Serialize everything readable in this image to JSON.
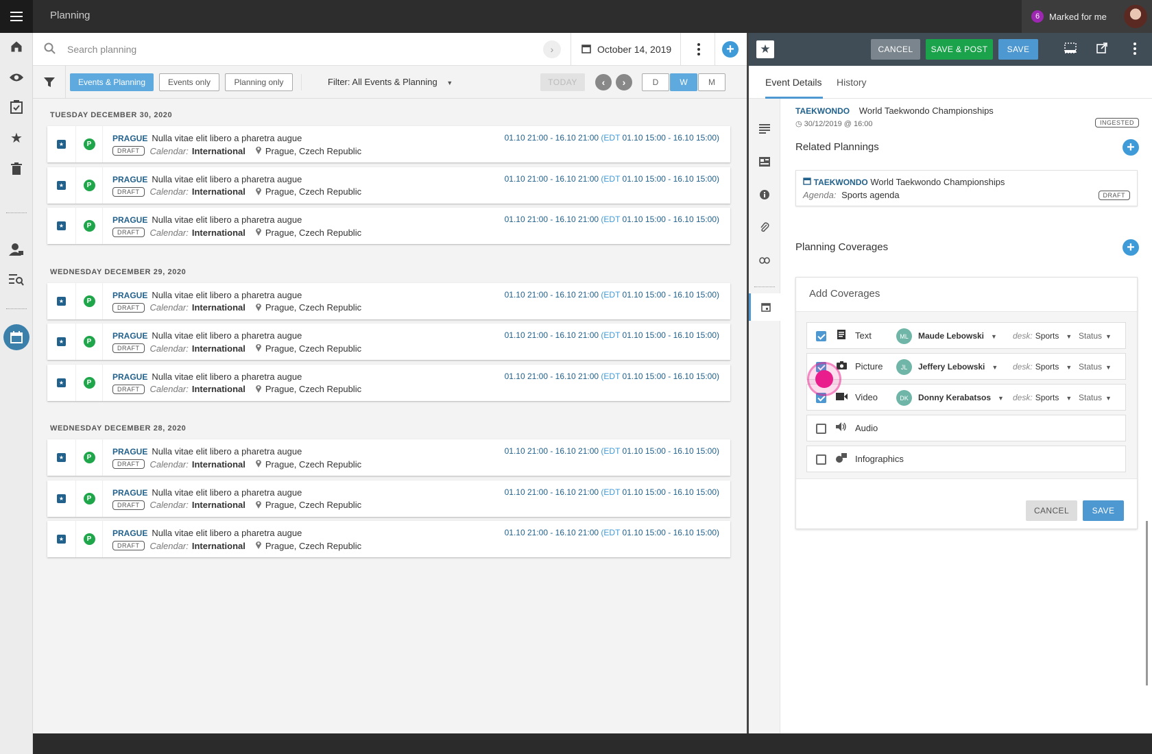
{
  "app": {
    "title": "Planning",
    "marked_count": "6",
    "marked_label": "Marked for me"
  },
  "search": {
    "placeholder": "Search planning",
    "date": "October 14, 2019"
  },
  "filters": {
    "tabs": [
      "Events & Planning",
      "Events only",
      "Planning only"
    ],
    "active_tab": 0,
    "dropdown": "Filter: All Events & Planning",
    "today": "TODAY",
    "views": [
      "D",
      "W",
      "M"
    ],
    "active_view": 1
  },
  "list": {
    "groups": [
      {
        "header": "TUESDAY  DECEMBER 30, 2020",
        "items": [
          {
            "slug": "PRAGUE",
            "title": "Nulla vitae elit libero a pharetra augue",
            "status": "DRAFT",
            "calendar_label": "Calendar:",
            "calendar": "International",
            "location": "Prague, Czech Republic",
            "time": "01.10 21:00 - 16.10 21:00",
            "edt_open": "(EDT",
            "edt_time": "01.10 15:00 - 16.10 15:00)"
          },
          {
            "slug": "PRAGUE",
            "title": "Nulla vitae elit libero a pharetra augue",
            "status": "DRAFT",
            "calendar_label": "Calendar:",
            "calendar": "International",
            "location": "Prague, Czech Republic",
            "time": "01.10 21:00 - 16.10 21:00",
            "edt_open": "(EDT",
            "edt_time": "01.10 15:00 - 16.10 15:00)"
          },
          {
            "slug": "PRAGUE",
            "title": "Nulla vitae elit libero a pharetra augue",
            "status": "DRAFT",
            "calendar_label": "Calendar:",
            "calendar": "International",
            "location": "Prague, Czech Republic",
            "time": "01.10 21:00 - 16.10 21:00",
            "edt_open": "(EDT",
            "edt_time": "01.10 15:00 - 16.10 15:00)"
          }
        ]
      },
      {
        "header": "WEDNESDAY  DECEMBER 29, 2020",
        "items": [
          {
            "slug": "PRAGUE",
            "title": "Nulla vitae elit libero a pharetra augue",
            "status": "DRAFT",
            "calendar_label": "Calendar:",
            "calendar": "International",
            "location": "Prague, Czech Republic",
            "time": "01.10 21:00 - 16.10 21:00",
            "edt_open": "(EDT",
            "edt_time": "01.10 15:00 - 16.10 15:00)"
          },
          {
            "slug": "PRAGUE",
            "title": "Nulla vitae elit libero a pharetra augue",
            "status": "DRAFT",
            "calendar_label": "Calendar:",
            "calendar": "International",
            "location": "Prague, Czech Republic",
            "time": "01.10 21:00 - 16.10 21:00",
            "edt_open": "(EDT",
            "edt_time": "01.10 15:00 - 16.10 15:00)"
          },
          {
            "slug": "PRAGUE",
            "title": "Nulla vitae elit libero a pharetra augue",
            "status": "DRAFT",
            "calendar_label": "Calendar:",
            "calendar": "International",
            "location": "Prague, Czech Republic",
            "time": "01.10 21:00 - 16.10 21:00",
            "edt_open": "(EDT",
            "edt_time": "01.10 15:00 - 16.10 15:00)"
          }
        ]
      },
      {
        "header": "WEDNESDAY  DECEMBER 28, 2020",
        "items": [
          {
            "slug": "PRAGUE",
            "title": "Nulla vitae elit libero a pharetra augue",
            "status": "DRAFT",
            "calendar_label": "Calendar:",
            "calendar": "International",
            "location": "Prague, Czech Republic",
            "time": "01.10 21:00 - 16.10 21:00",
            "edt_open": "(EDT",
            "edt_time": "01.10 15:00 - 16.10 15:00)"
          },
          {
            "slug": "PRAGUE",
            "title": "Nulla vitae elit libero a pharetra augue",
            "status": "DRAFT",
            "calendar_label": "Calendar:",
            "calendar": "International",
            "location": "Prague, Czech Republic",
            "time": "01.10 21:00 - 16.10 21:00",
            "edt_open": "(EDT",
            "edt_time": "01.10 15:00 - 16.10 15:00)"
          },
          {
            "slug": "PRAGUE",
            "title": "Nulla vitae elit libero a pharetra augue",
            "status": "DRAFT",
            "calendar_label": "Calendar:",
            "calendar": "International",
            "location": "Prague, Czech Republic",
            "time": "01.10 21:00 - 16.10 21:00",
            "edt_open": "(EDT",
            "edt_time": "01.10 15:00 - 16.10 15:00)"
          }
        ]
      }
    ]
  },
  "editor": {
    "toolbar": {
      "cancel": "CANCEL",
      "save_post": "SAVE & POST",
      "save": "SAVE"
    },
    "tabs": [
      "Event Details",
      "History"
    ],
    "event": {
      "slug": "TAEKWONDO",
      "name": "World Taekwondo Championships",
      "datetime": "30/12/2019 @ 16:00",
      "badge": "INGESTED"
    },
    "related": {
      "title": "Related Plannings",
      "slug": "TAEKWONDO",
      "name": "World Taekwondo Championships",
      "agenda_label": "Agenda:",
      "agenda": "Sports agenda",
      "status": "DRAFT"
    },
    "coverages": {
      "title": "Planning Coverages",
      "add_title": "Add Coverages",
      "rows": [
        {
          "type": "Text",
          "icon": "text-doc-icon",
          "checked": true,
          "initials": "ML",
          "assignee": "Maude Lebowski",
          "desk_label": "desk:",
          "desk": "Sports",
          "status": "Status"
        },
        {
          "type": "Picture",
          "icon": "camera-icon",
          "checked": true,
          "initials": "JL",
          "assignee": "Jeffery Lebowski",
          "desk_label": "desk:",
          "desk": "Sports",
          "status": "Status"
        },
        {
          "type": "Video",
          "icon": "video-camera-icon",
          "checked": true,
          "initials": "DK",
          "assignee": "Donny Kerabatsos",
          "desk_label": "desk:",
          "desk": "Sports",
          "status": "Status"
        },
        {
          "type": "Audio",
          "icon": "speaker-icon",
          "checked": false
        },
        {
          "type": "Infographics",
          "icon": "shapes-icon",
          "checked": false
        }
      ],
      "cancel": "CANCEL",
      "save": "SAVE"
    }
  },
  "colors": {
    "accent": "#4e98d2",
    "slug": "#21618c",
    "green": "#1aa34a",
    "toolbar": "#404d57",
    "click": "#e91e8c"
  }
}
